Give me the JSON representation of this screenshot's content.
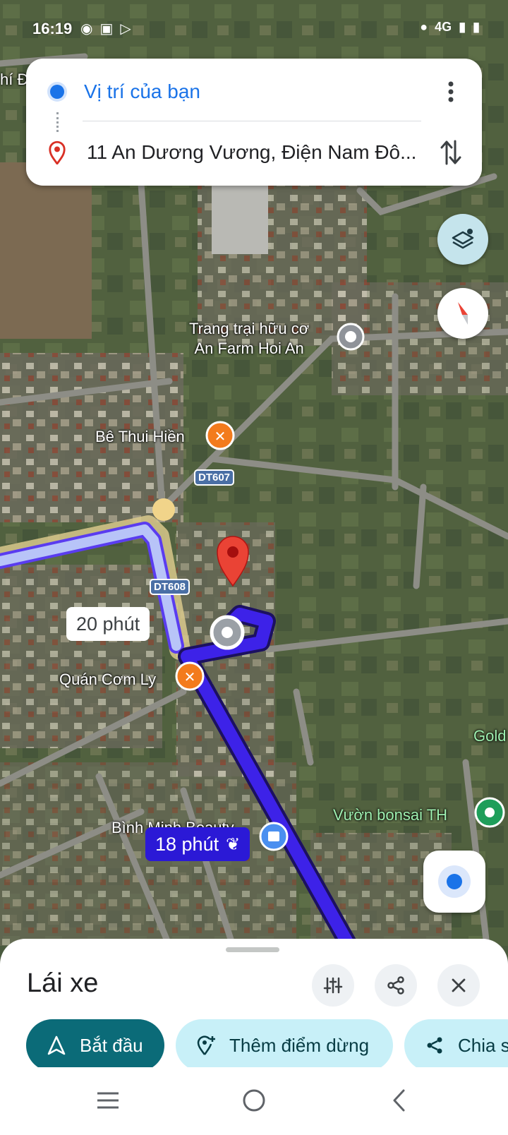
{
  "status_bar": {
    "time": "16:19",
    "network": "4G"
  },
  "directions": {
    "origin": "Vị trí của bạn",
    "destination": "11 An Dương Vương, Điện Nam Đô..."
  },
  "map": {
    "labels": {
      "farm_line1": "Trang trại hữu cơ",
      "farm_line2": "An Farm Hoi An",
      "restaurant1": "Bê Thui Hiền",
      "restaurant2": "Quán Cơm Ly",
      "beauty": "Bình Minh Beauty",
      "bonsai": "Vườn bonsai TH",
      "gold_partial": "Gold",
      "left_partial": "hí Đ"
    },
    "roads": {
      "dt607": "DT607",
      "dt608": "DT608"
    },
    "routes": {
      "alt_time": "20 phút",
      "main_time": "18 phút"
    }
  },
  "sheet": {
    "mode_title": "Lái xe",
    "start_label": "Bắt đầu",
    "add_stop_label": "Thêm điểm dừng",
    "share_label": "Chia s"
  },
  "colors": {
    "route_main": "#3d22e8",
    "route_alt": "#b8c4f8",
    "accent": "#1a73e8",
    "start_bg": "#0b6b78",
    "pill_bg": "#c8f0f8"
  }
}
